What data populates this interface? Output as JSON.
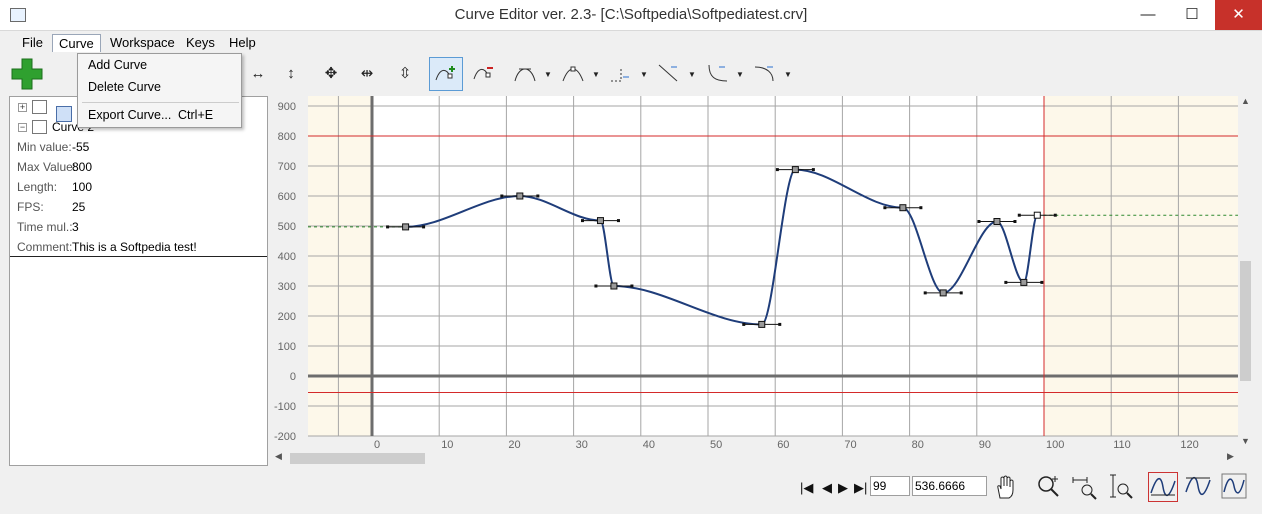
{
  "window": {
    "title": "Curve Editor ver. 2.3- [C:\\Softpedia\\Softpediatest.crv]",
    "min_symbol": "—",
    "max_symbol": "☐",
    "close_symbol": "✕"
  },
  "menu": {
    "items": [
      "File",
      "Curve",
      "Workspace",
      "Keys",
      "Help"
    ]
  },
  "dropdown": {
    "add_curve": "Add Curve",
    "delete_curve": "Delete Curve",
    "export_curve": "Export Curve...",
    "export_shortcut": "Ctrl+E"
  },
  "tree": {
    "curve_label": "Curve 2"
  },
  "properties": [
    {
      "label": "Min value:",
      "value": "-55"
    },
    {
      "label": "Max Value:",
      "value": "800"
    },
    {
      "label": "Length:",
      "value": "100"
    },
    {
      "label": "FPS:",
      "value": "25"
    },
    {
      "label": "Time mul.:",
      "value": "3"
    },
    {
      "label": "Comment:",
      "value": "This is a Softpedia test!"
    }
  ],
  "graph": {
    "y_ticks": [
      "900",
      "800",
      "700",
      "600",
      "500",
      "400",
      "300",
      "200",
      "100",
      "0",
      "-100",
      "-200"
    ],
    "x_ticks": [
      "0",
      "10",
      "20",
      "30",
      "40",
      "50",
      "60",
      "70",
      "80",
      "90",
      "100",
      "110",
      "120"
    ],
    "colors": {
      "outside_bg": "#fdf8ea",
      "inside_bg": "#ffffff",
      "grid": "#a6a6a6",
      "axis": "#6d6d6d",
      "limit": "#d42a2a",
      "curve": "#1f3d7a",
      "extension": "#2f8a2f"
    },
    "min_value": -55,
    "max_value": 800,
    "length": 100,
    "keys": [
      {
        "t": 5,
        "v": 497
      },
      {
        "t": 22,
        "v": 600
      },
      {
        "t": 34,
        "v": 518
      },
      {
        "t": 36,
        "v": 300
      },
      {
        "t": 58,
        "v": 172
      },
      {
        "t": 63,
        "v": 688
      },
      {
        "t": 79,
        "v": 561
      },
      {
        "t": 85,
        "v": 277
      },
      {
        "t": 93,
        "v": 515
      },
      {
        "t": 97,
        "v": 312
      },
      {
        "t": 99,
        "v": 536
      }
    ]
  },
  "bottom": {
    "frame": "99",
    "value": "536.6666",
    "first": "|◀",
    "prev": "◀",
    "next": "▶",
    "last": "▶|"
  }
}
